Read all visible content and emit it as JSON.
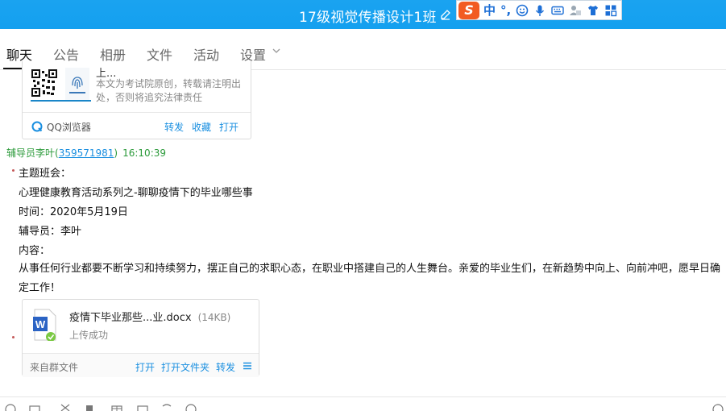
{
  "window": {
    "title": "17级视觉传播设计1班",
    "title_bar_color": "#14a0ef"
  },
  "ime": {
    "logo": "S",
    "mode": "中",
    "punct": "°,",
    "icons": [
      "smiley-icon",
      "microphone-icon",
      "keyboard-icon",
      "user-icon",
      "shirt-icon",
      "grid-icon"
    ]
  },
  "tabs": [
    {
      "label": "聊天",
      "active": true
    },
    {
      "label": "公告"
    },
    {
      "label": "相册"
    },
    {
      "label": "文件"
    },
    {
      "label": "活动"
    },
    {
      "label": "设置"
    }
  ],
  "shared_card": {
    "title": "上...",
    "description": "本文为考试院原创，转载请注明出处，否则将追究法律责任",
    "source": "QQ浏览器",
    "actions": [
      "转发",
      "收藏",
      "打开"
    ]
  },
  "message": {
    "sender": "辅导员李叶",
    "qq_number": "359571981",
    "time": "16:10:39",
    "lines": [
      "主题班会：",
      "心理健康教育活动系列之-聊聊疫情下的毕业哪些事",
      "时间：2020年5月19日",
      "辅导员：李叶",
      "内容："
    ],
    "body": " 从事任何行业都要不断学习和持续努力，摆正自己的求职心态，在职业中搭建自己的人生舞台。亲爱的毕业生们，在新趋势中向上、向前冲吧，愿早日确定工作！"
  },
  "file_card": {
    "file_name": "疫情下毕业那些...业.docx",
    "file_size": "(14KB)",
    "status": "上传成功",
    "from": "来自群文件",
    "actions": [
      "打开",
      "打开文件夹",
      "转发"
    ]
  }
}
